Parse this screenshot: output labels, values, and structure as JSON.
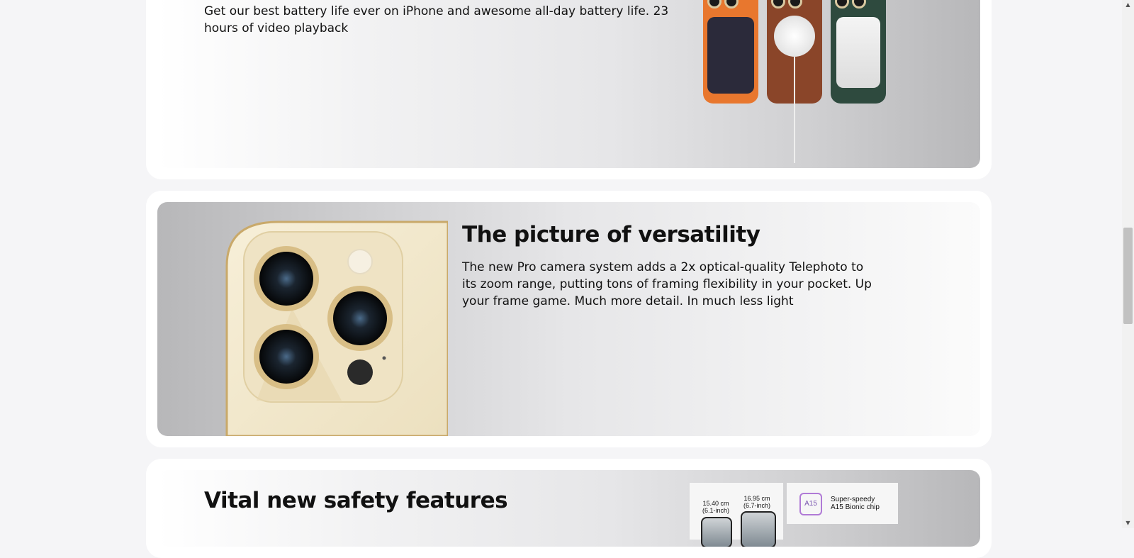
{
  "battery_section": {
    "body_line1": "Get our best battery life ever on iPhone and awesome all-day battery life. 23",
    "body_line2": "hours of video playback"
  },
  "camera_section": {
    "title": "The picture of versatility",
    "body": "The new Pro camera system adds a 2x optical-quality Telephoto to its zoom range, putting tons of framing flexibility in your pocket. Up your frame game. Much more detail. In much less light"
  },
  "safety_section": {
    "title": "Vital new safety features",
    "spec_small_size": "15.40 cm",
    "spec_small_inch": "(6.1-inch)",
    "spec_large_size": "16.95 cm",
    "spec_large_inch": "(6.7-inch)",
    "chip_badge": "A15",
    "chip_line1": "Super-speedy",
    "chip_line2": "A15 Bionic chip"
  },
  "colors": {
    "case_orange": "#e8772e",
    "case_brown": "#8a4529",
    "case_green": "#2e4a3e",
    "camera_gold": "#f3e9cf"
  },
  "icons": [
    "scroll-up-arrow-icon",
    "scroll-down-arrow-icon"
  ]
}
